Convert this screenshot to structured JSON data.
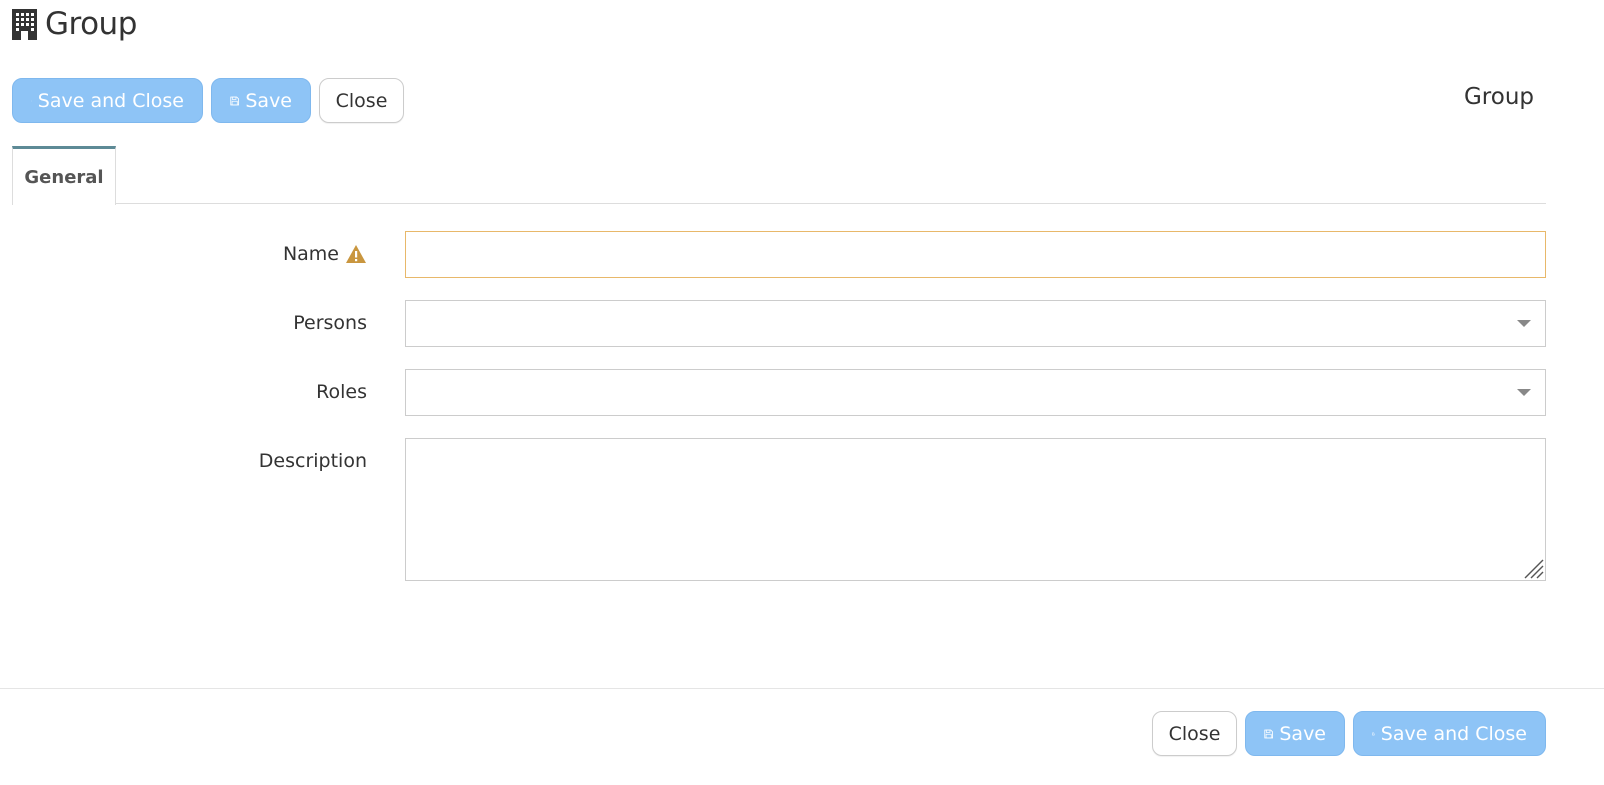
{
  "header": {
    "title": "Group",
    "icon": "building-icon",
    "form_tag": "Group"
  },
  "toolbar_top": {
    "save_and_close_label": "Save and Close",
    "save_label": "Save",
    "close_label": "Close"
  },
  "tabs": [
    {
      "label": "General",
      "active": true
    }
  ],
  "form": {
    "name": {
      "label": "Name",
      "value": "",
      "placeholder": "",
      "validation": "warning"
    },
    "persons": {
      "label": "Persons",
      "value": ""
    },
    "roles": {
      "label": "Roles",
      "value": ""
    },
    "description": {
      "label": "Description",
      "value": ""
    }
  },
  "toolbar_bottom": {
    "close_label": "Close",
    "save_label": "Save",
    "save_and_close_label": "Save and Close"
  },
  "colors": {
    "primary_button": "#8ec4f6",
    "warning_border": "#e8b86a",
    "warning_icon": "#c9963f",
    "tab_accent": "#5d8a96"
  }
}
